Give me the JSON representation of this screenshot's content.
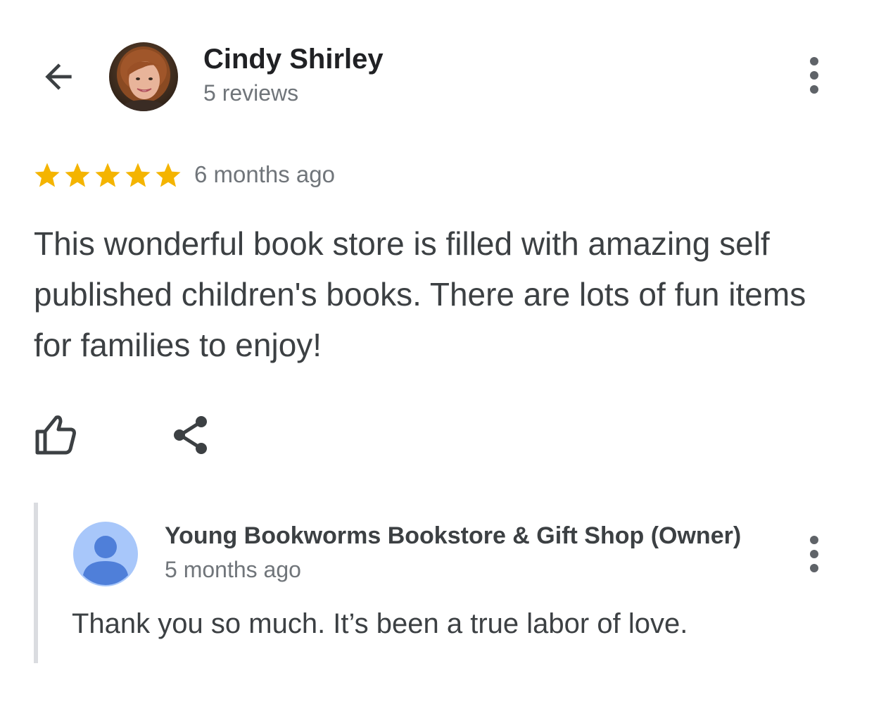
{
  "header": {
    "back_icon": "arrow-back-icon",
    "reviewer_name": "Cindy Shirley",
    "review_count": "5 reviews",
    "more_icon": "more-vert-icon"
  },
  "review": {
    "rating": 5,
    "rating_max": 5,
    "star_color": "#f4b400",
    "time": "6 months ago",
    "text": "This wonderful book store is filled with amazing self published children's books. There are lots of fun items for families to enjoy!",
    "actions": {
      "like_icon": "thumbs-up-icon",
      "share_icon": "share-icon"
    }
  },
  "owner_response": {
    "name": "Young Bookworms Bookstore & Gift Shop (Owner)",
    "time": "5 months ago",
    "text": "Thank you so much. It’s been a true labor of love.",
    "avatar_icon": "person-avatar-icon",
    "avatar_bg": "#a8c7fa",
    "avatar_fg": "#4f7fd9",
    "more_icon": "more-vert-icon"
  }
}
